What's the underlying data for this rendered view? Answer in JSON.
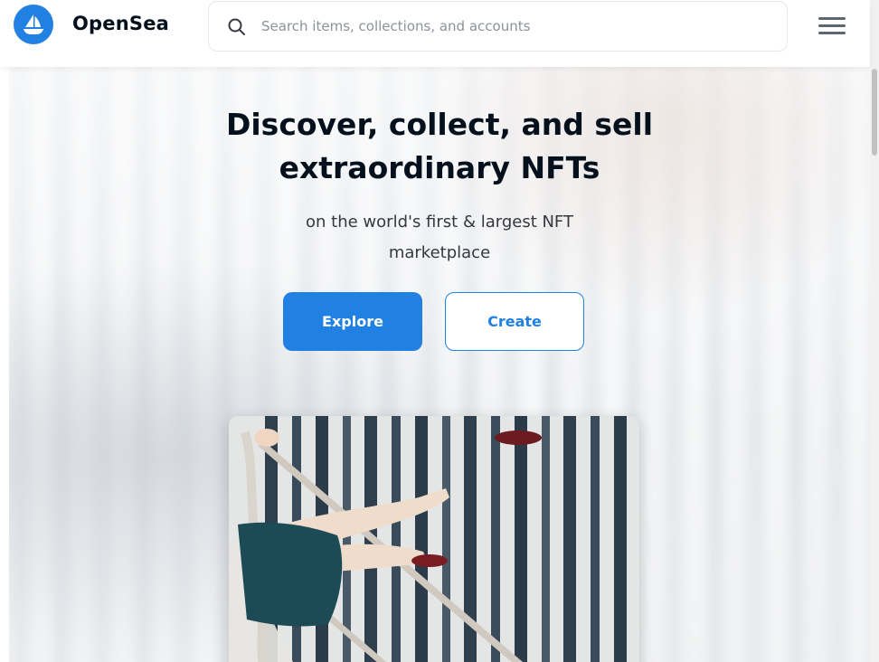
{
  "header": {
    "brand": "OpenSea",
    "search_placeholder": "Search items, collections, and accounts",
    "logo_icon": "opensea-boat-icon",
    "menu_icon": "hamburger-menu-icon",
    "search_icon": "search-icon"
  },
  "hero": {
    "title_line1": "Discover, collect, and sell",
    "title_line2": "extraordinary NFTs",
    "subtitle_line1": "on the world's first & largest NFT",
    "subtitle_line2": "marketplace",
    "explore_label": "Explore",
    "create_label": "Create"
  },
  "colors": {
    "accent": "#2081e2",
    "text_dark": "#04111d",
    "text_muted": "#353840"
  }
}
